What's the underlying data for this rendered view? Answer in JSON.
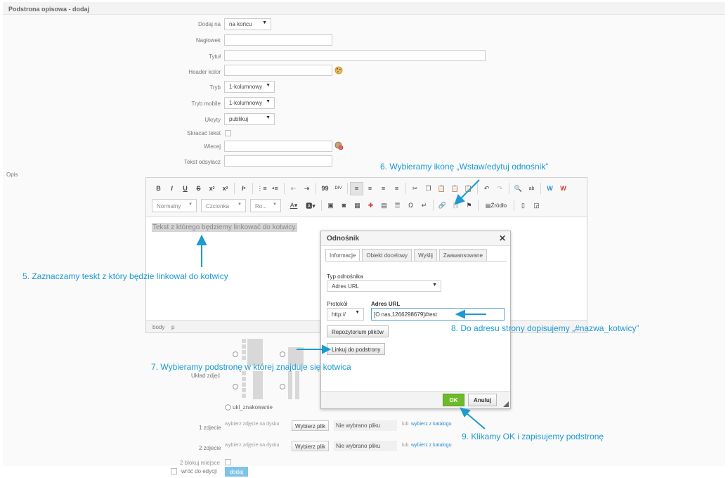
{
  "page": {
    "title": "Podstrona opisowa - dodaj"
  },
  "form": {
    "dodaj_na": {
      "label": "Dodaj na",
      "value": "na końcu"
    },
    "naglowek": {
      "label": "Nagłowek"
    },
    "tytul": {
      "label": "Tytuł"
    },
    "header_kolor": {
      "label": "Header kolor"
    },
    "tryb": {
      "label": "Tryb",
      "value": "1-kolumnowy"
    },
    "tryb_mobile": {
      "label": "Tryb mobile",
      "value": "1-kolumnowy"
    },
    "ukryty": {
      "label": "Ukryty",
      "value": "publikuj"
    },
    "skracac": {
      "label": "Skracać tekst"
    },
    "wiecej": {
      "label": "Wiecej"
    },
    "tekst_odsylacz": {
      "label": "Tekst odsyłacz"
    },
    "opis": {
      "label": "Opis"
    },
    "uklad_zdjec": {
      "label": "Układ zdjęć"
    },
    "ukl_znak": {
      "label": "ukl_znakowanie"
    },
    "zdjecie1": {
      "label": "1 zdjecie"
    },
    "zdjecie2": {
      "label": "2 zdjecie"
    },
    "photo_hint": "wybierz zdjęcie na dysku",
    "file_btn": "Wybierz plik",
    "file_none": "Nie wybrano pliku",
    "lub": "lub",
    "from_catalog": "wybierz z katalogu",
    "blokuj": {
      "label": "2 blokuj miejsce"
    },
    "wroc": {
      "label": "wróć do edycji"
    },
    "submit": "dodaj"
  },
  "editor": {
    "combos": [
      "Normalny",
      "Czcionka",
      "Ro..."
    ],
    "source_label": "Źródło",
    "content": "Tekst z którego będziemy linkować do kotwicy.",
    "footer_path": [
      "body",
      "p"
    ]
  },
  "dialog": {
    "title": "Odnośnik",
    "close": "✕",
    "tabs": [
      "Informacje",
      "Obiekt docelowy",
      "Wyślij",
      "Zaawansowane"
    ],
    "link_type_label": "Typ odnośnika",
    "link_type_value": "Adres URL",
    "protocol_label": "Protokół",
    "protocol_value": "http://",
    "url_label": "Adres URL",
    "url_value": "[O nas,1266298679]#test",
    "repo_button": "Repozytorium plików",
    "subpage_button": "Linkuj do podstrony",
    "ok": "OK",
    "cancel": "Anuluj"
  },
  "annotations": {
    "step5": "5. Zaznaczamy teskt z który będzie linkował do kotwicy",
    "step6": "6. Wybieramy ikonę „Wstaw/edytuj odnośnik”",
    "step7": "7. Wybieramy podstronę w której znajduje się kotwica",
    "step8": "8. Do adresu strony dopisujemy „#nazwa_kotwicy”",
    "step9": "9. Klikamy OK i zapisujemy podstronę"
  },
  "colors": {
    "annotation": "#1b9ad3",
    "ok_button": "#6fba2c",
    "submit_button": "#7fc4e8"
  }
}
